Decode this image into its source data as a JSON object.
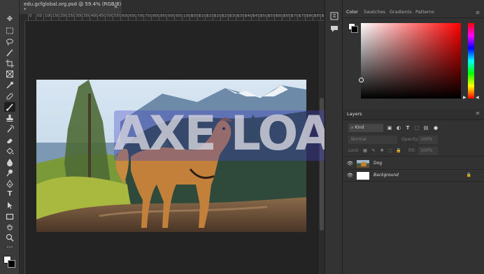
{
  "document_tab": {
    "title": "edu.gcfglobal.org.psd @ 59.4% (RGB/8) *",
    "close_symbol": "×"
  },
  "ruler": {
    "ticks": [
      "0",
      "50",
      "100",
      "150",
      "200",
      "250",
      "300",
      "350",
      "400",
      "450",
      "500",
      "550",
      "600",
      "650",
      "700",
      "750",
      "800",
      "850",
      "900",
      "950",
      "1000",
      "1050",
      "1100",
      "1150",
      "1200",
      "1250",
      "1300",
      "1350",
      "1400",
      "1450",
      "1500",
      "1550",
      "1600",
      "1650",
      "1700",
      "1750",
      "1800",
      "1850",
      "1900"
    ]
  },
  "tools": [
    "move-tool",
    "marquee-tool",
    "lasso-tool",
    "magic-wand-tool",
    "crop-tool",
    "frame-tool",
    "eyedropper-tool",
    "healing-brush-tool",
    "brush-tool",
    "clone-stamp-tool",
    "history-brush-tool",
    "eraser-tool",
    "paint-bucket-tool",
    "blur-tool",
    "dodge-tool",
    "pen-tool",
    "type-tool",
    "path-selection-tool",
    "rectangle-tool",
    "hand-tool",
    "zoom-tool",
    "more-tools"
  ],
  "active_tool": "brush-tool",
  "color_panel": {
    "tabs": [
      "Color",
      "Swatches",
      "Gradients",
      "Patterns"
    ],
    "active_tab": "Color",
    "menu_symbol": "≡",
    "hue_color": "#ff0000"
  },
  "layers_panel": {
    "title": "Layers",
    "menu_symbol": "≡",
    "kind_filter": "Kind",
    "blend_mode": "Normal",
    "opacity_label": "Opacity:",
    "opacity_value": "100%",
    "lock_label": "Lock:",
    "fill_label": "Fill:",
    "fill_value": "100%",
    "layers": [
      {
        "name": "Dog",
        "visible": true,
        "italic": false
      },
      {
        "name": "Background",
        "visible": true,
        "italic": true,
        "locked": true
      }
    ]
  },
  "watermark": {
    "text": "AXE LOAD"
  }
}
